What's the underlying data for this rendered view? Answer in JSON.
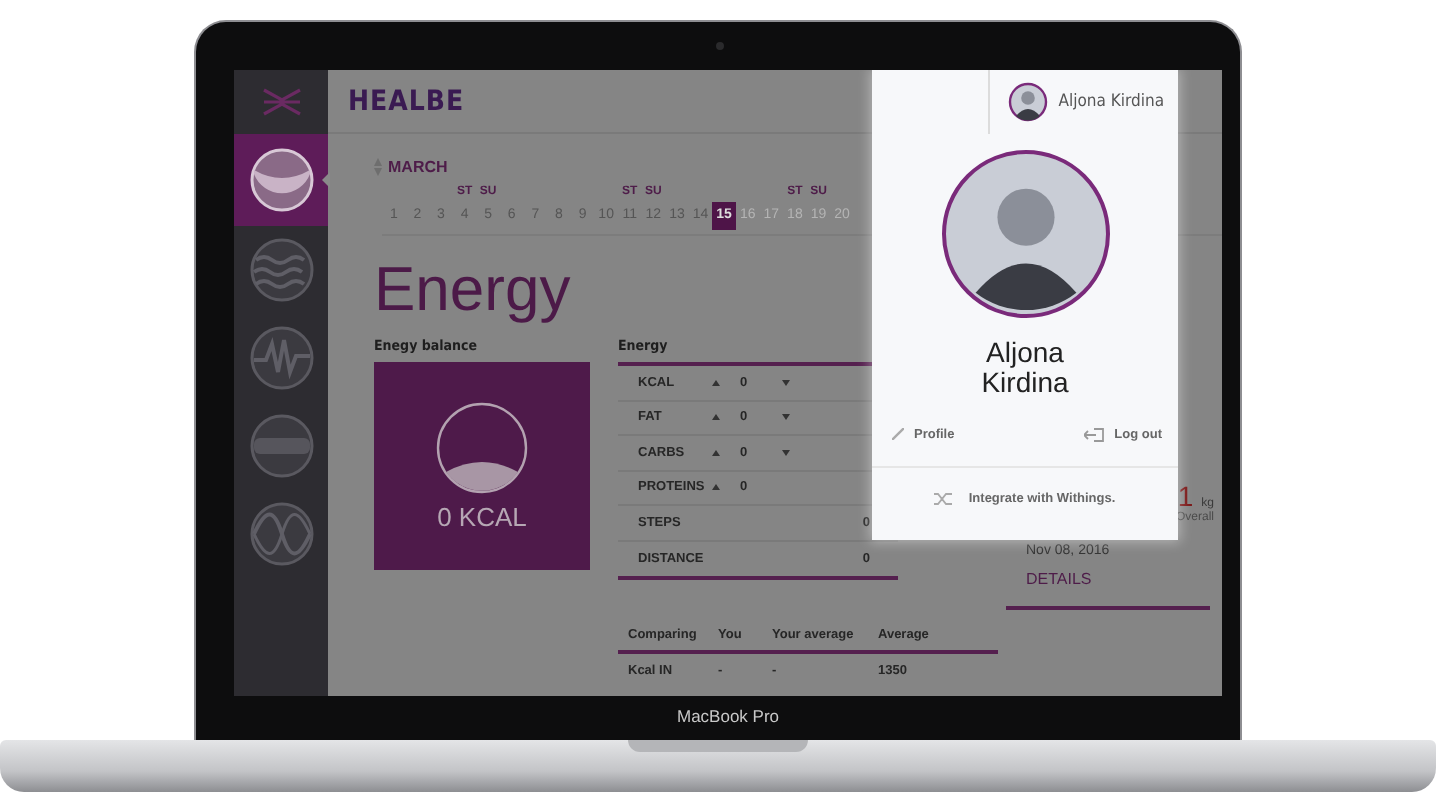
{
  "header": {
    "logo": "HEALBE"
  },
  "sidebar": {
    "items": [
      {
        "kind": "bowl",
        "selected": true
      },
      {
        "kind": "waves",
        "selected": false
      },
      {
        "kind": "pulse",
        "selected": false
      },
      {
        "kind": "band",
        "selected": false
      },
      {
        "kind": "sine",
        "selected": false
      }
    ]
  },
  "calendar": {
    "month": "MARCH",
    "days": [
      {
        "label": "1",
        "future": false,
        "selected": false
      },
      {
        "label": "2",
        "future": false,
        "selected": false
      },
      {
        "label": "3",
        "future": false,
        "selected": false
      },
      {
        "label": "4",
        "weekday": "ST",
        "future": false,
        "selected": false
      },
      {
        "label": "5",
        "weekday": "SU",
        "future": false,
        "selected": false
      },
      {
        "label": "6",
        "future": false,
        "selected": false
      },
      {
        "label": "7",
        "future": false,
        "selected": false
      },
      {
        "label": "8",
        "future": false,
        "selected": false
      },
      {
        "label": "9",
        "future": false,
        "selected": false
      },
      {
        "label": "10",
        "future": false,
        "selected": false
      },
      {
        "label": "11",
        "weekday": "ST",
        "future": false,
        "selected": false
      },
      {
        "label": "12",
        "weekday": "SU",
        "future": false,
        "selected": false
      },
      {
        "label": "13",
        "future": false,
        "selected": false
      },
      {
        "label": "14",
        "future": false,
        "selected": false
      },
      {
        "label": "15",
        "future": false,
        "selected": true
      },
      {
        "label": "16",
        "future": true,
        "selected": false
      },
      {
        "label": "17",
        "future": true,
        "selected": false
      },
      {
        "label": "18",
        "weekday": "ST",
        "future": true,
        "selected": false
      },
      {
        "label": "19",
        "weekday": "SU",
        "future": true,
        "selected": false
      },
      {
        "label": "20",
        "future": true,
        "selected": false
      }
    ]
  },
  "page_title": "Energy",
  "balance": {
    "label": "Enegy balance",
    "value": "0 KCAL"
  },
  "energy": {
    "label": "Energy",
    "rows": [
      {
        "kind": "adjust",
        "name": "KCAL",
        "value": "0",
        "down": true
      },
      {
        "kind": "adjust",
        "name": "FAT",
        "value": "0",
        "down": true
      },
      {
        "kind": "adjust",
        "name": "CARBS",
        "value": "0",
        "down": true
      },
      {
        "kind": "adjust",
        "name": "PROTEINS",
        "value": "0",
        "down": false
      },
      {
        "kind": "total",
        "name": "STEPS",
        "value": "0"
      },
      {
        "kind": "total",
        "name": "DISTANCE",
        "value": "0"
      }
    ]
  },
  "comparing": {
    "columns": [
      "Comparing",
      "You",
      "Your average",
      "Average"
    ],
    "rows": [
      [
        "Kcal IN",
        "-",
        "-",
        "1350"
      ]
    ]
  },
  "weight": {
    "value": "1",
    "unit": "kg",
    "caption": "Overall",
    "date": "Nov 08, 2016",
    "link": "DETAILS"
  },
  "user_menu": {
    "name": "Aljona Kirdina",
    "full_name": "Aljona Kirdina",
    "profile": "Profile",
    "logout": "Log out",
    "integration": "Integrate with Withings."
  },
  "device_caption": "MacBook Pro"
}
